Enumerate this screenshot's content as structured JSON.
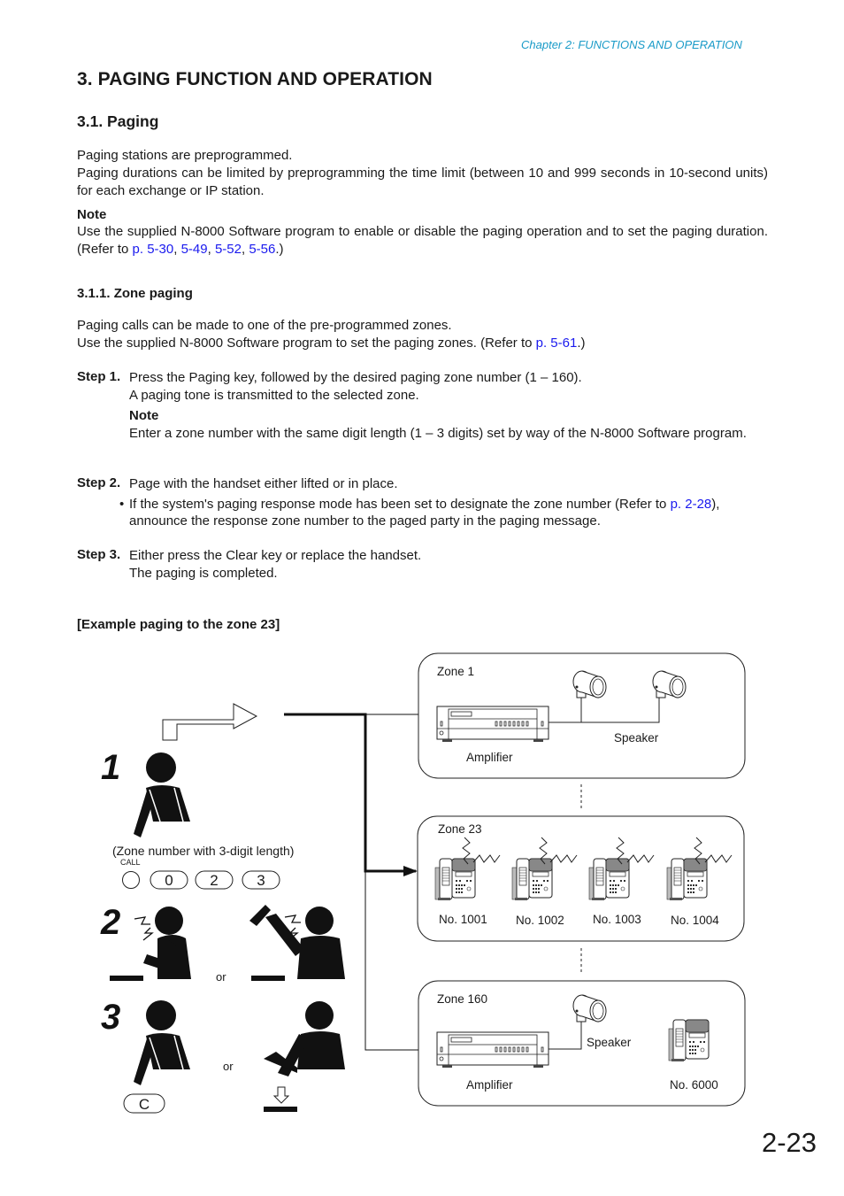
{
  "header": {
    "chapter": "Chapter 2:  FUNCTIONS AND OPERATION"
  },
  "section": {
    "title": "3. PAGING FUNCTION AND OPERATION",
    "subsection_title": "3.1. Paging",
    "intro_line1": "Paging stations are preprogrammed.",
    "intro_line2": "Paging durations can be limited by preprogramming the time limit (between 10 and 999 seconds in 10-second units) for each exchange or IP station.",
    "note": {
      "label": "Note",
      "text_before": "Use the supplied N-8000 Software program to enable or disable the paging operation and to set the paging duration. (Refer to ",
      "links": [
        "p. 5-30",
        "5-49",
        "5-52",
        "5-56"
      ],
      "sep": ", ",
      "text_after": ".)"
    }
  },
  "zone_paging": {
    "title": "3.1.1. Zone paging",
    "line1": "Paging calls can be made to one of the pre-programmed zones.",
    "line2_before": "Use the supplied N-8000 Software program to set the paging zones. (Refer to ",
    "line2_link": "p. 5-61",
    "line2_after": ".)",
    "steps": [
      {
        "label": "Step 1.",
        "line1": "Press the Paging key, followed by the desired paging zone number (1 – 160).",
        "line2": "A paging tone is transmitted to the selected zone.",
        "note_label": "Note",
        "note_text": "Enter a zone number with the same digit length (1 – 3 digits) set by way of the N-8000 Software program."
      },
      {
        "label": "Step 2.",
        "line1": "Page with the handset either lifted or in place.",
        "bullet_before": "If the system's paging response mode has been set to designate the zone number (Refer to ",
        "bullet_link": "p. 2-28",
        "bullet_after": "), announce the response zone number to the paged party in the paging message."
      },
      {
        "label": "Step 3.",
        "line1": "Either press the Clear key or replace the handset.",
        "line2": "The paging is completed."
      }
    ]
  },
  "example": {
    "title": "[Example paging to the zone 23]",
    "step_numbers": [
      "1",
      "2",
      "3"
    ],
    "zone_hint": "(Zone number with 3-digit length)",
    "call_label": "CALL",
    "keys": [
      "0",
      "2",
      "3"
    ],
    "clear_key": "C",
    "or_label": "or",
    "zones": [
      {
        "name": "Zone 1",
        "amplifier": "Amplifier",
        "speaker": "Speaker"
      },
      {
        "name": "Zone 23",
        "stations": [
          "No. 1001",
          "No. 1002",
          "No. 1003",
          "No. 1004"
        ]
      },
      {
        "name": "Zone 160",
        "amplifier": "Amplifier",
        "speaker": "Speaker",
        "station": "No. 6000"
      }
    ]
  },
  "footer": {
    "page_number": "2-23"
  },
  "colors": {
    "chapter_text": "#1a9bc8",
    "link": "#1a1aee",
    "text": "#1a1a1a"
  }
}
